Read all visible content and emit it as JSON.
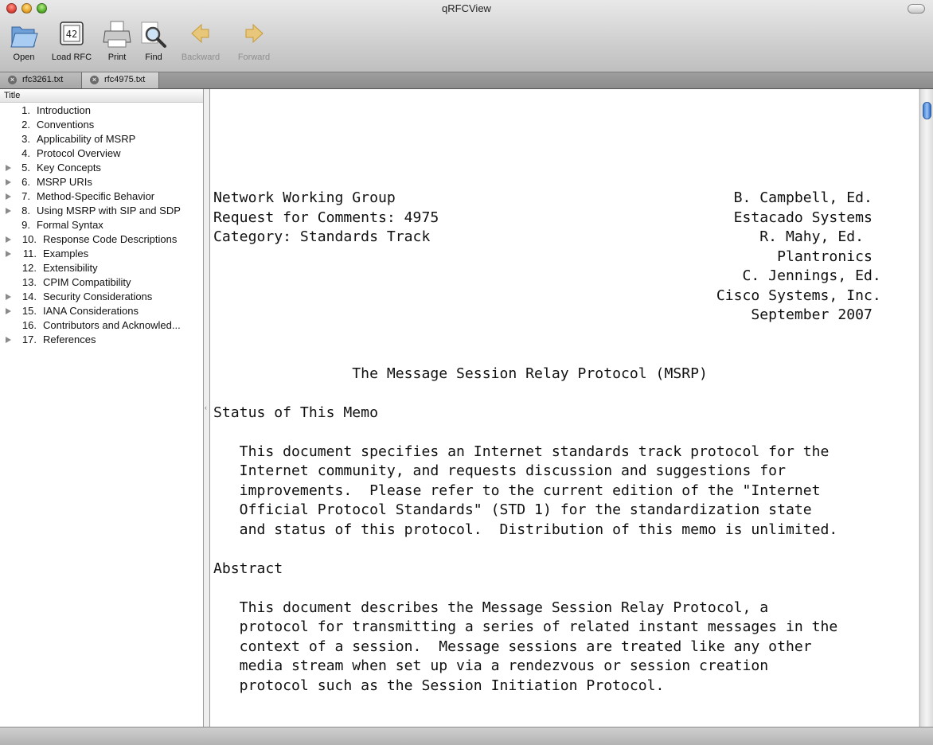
{
  "window": {
    "title": "qRFCView"
  },
  "toolbar": {
    "open": "Open",
    "load_rfc": "Load RFC",
    "load_rfc_icon_text": "42",
    "print": "Print",
    "find": "Find",
    "backward": "Backward",
    "forward": "Forward"
  },
  "tabs": [
    {
      "label": "rfc3261.txt"
    },
    {
      "label": "rfc4975.txt"
    }
  ],
  "sidebar": {
    "column_header": "Title",
    "items": [
      {
        "num": "1.",
        "label": "Introduction"
      },
      {
        "num": "2.",
        "label": "Conventions"
      },
      {
        "num": "3.",
        "label": "Applicability of MSRP"
      },
      {
        "num": "4.",
        "label": "Protocol Overview"
      },
      {
        "num": "5.",
        "label": "Key Concepts"
      },
      {
        "num": "6.",
        "label": "MSRP URIs"
      },
      {
        "num": "7.",
        "label": "Method-Specific Behavior"
      },
      {
        "num": "8.",
        "label": "Using MSRP with SIP and SDP"
      },
      {
        "num": "9.",
        "label": "Formal Syntax"
      },
      {
        "num": "10.",
        "label": "Response Code Descriptions"
      },
      {
        "num": "11.",
        "label": "Examples"
      },
      {
        "num": "12.",
        "label": "Extensibility"
      },
      {
        "num": "13.",
        "label": "CPIM Compatibility"
      },
      {
        "num": "14.",
        "label": "Security Considerations"
      },
      {
        "num": "15.",
        "label": "IANA Considerations"
      },
      {
        "num": "16.",
        "label": "Contributors and Acknowled..."
      },
      {
        "num": "17.",
        "label": "References"
      }
    ]
  },
  "document": {
    "text": "Network Working Group                                       B. Campbell, Ed.\nRequest for Comments: 4975                                  Estacado Systems\nCategory: Standards Track                                      R. Mahy, Ed.\n                                                                 Plantronics\n                                                             C. Jennings, Ed.\n                                                          Cisco Systems, Inc.\n                                                              September 2007\n\n\n                The Message Session Relay Protocol (MSRP)\n\nStatus of This Memo\n\n   This document specifies an Internet standards track protocol for the\n   Internet community, and requests discussion and suggestions for\n   improvements.  Please refer to the current edition of the \"Internet\n   Official Protocol Standards\" (STD 1) for the standardization state\n   and status of this protocol.  Distribution of this memo is unlimited.\n\nAbstract\n\n   This document describes the Message Session Relay Protocol, a\n   protocol for transmitting a series of related instant messages in the\n   context of a session.  Message sessions are treated like any other\n   media stream when set up via a rendezvous or session creation\n   protocol such as the Session Initiation Protocol."
  }
}
